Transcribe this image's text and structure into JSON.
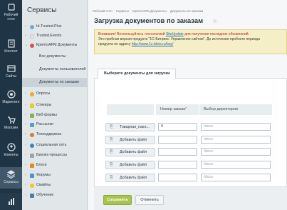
{
  "leftbar": {
    "items": [
      {
        "label1": "Рабочий",
        "label2": "стол"
      },
      {
        "label1": "Контент",
        "label2": ""
      },
      {
        "label1": "Сайты",
        "label2": ""
      },
      {
        "label1": "Маркетинг",
        "label2": ""
      },
      {
        "label1": "Магазин",
        "label2": ""
      },
      {
        "label1": "Клиенты",
        "label2": ""
      },
      {
        "label1": "Сервисы",
        "label2": ""
      }
    ]
  },
  "sidebar": {
    "title": "Сервисы",
    "items": [
      {
        "label": "Id.Trusted.Plus"
      },
      {
        "label": "Trusted.Events"
      },
      {
        "label": "КриптоАРМ Документы"
      },
      {
        "label": "Все документы"
      },
      {
        "label": "Документы пользователей"
      },
      {
        "label": "Документы по заказам"
      },
      {
        "label": "Опросы"
      },
      {
        "label": "Стикеры"
      },
      {
        "label": "Веб-формы"
      },
      {
        "label": "Рассылки"
      },
      {
        "label": "Техподдержка"
      },
      {
        "label": "Социальная сеть"
      },
      {
        "label": "Бизнес-процессы"
      },
      {
        "label": "Блоги"
      },
      {
        "label": "Форумы"
      },
      {
        "label": "Смайлы"
      },
      {
        "label": "Обучение"
      }
    ]
  },
  "breadcrumb": [
    "Рабочий стол",
    "Сервисы",
    "КриптоАРМ Документы",
    "Документы по заказам"
  ],
  "page": {
    "title": "Загрузка документов по заказам",
    "star": "☆"
  },
  "notice": {
    "line1_red": "Внимание! Воспользуйтесь технологией ",
    "link1": "SiteUpdate",
    "line1_rest": " для получения последних обновлений.",
    "line2": "Это пробная версия продукта \"1С-Битрикс: Управление сайтом\". До истечения пробного периода",
    "line3": "продукта по адресу ",
    "link2": "http://www.1c-bitrix.ru/buy/"
  },
  "tab": {
    "label": "Выберите документы для загрузки"
  },
  "table": {
    "col_order": "Номер заказа",
    "col_order_req": "*",
    "col_dir": "Выбор директории",
    "rows": [
      {
        "button": "Товарная_накл...",
        "order": "9",
        "dir": "/docs"
      },
      {
        "button": "Добавить файл",
        "order": "",
        "dir": "/docs"
      },
      {
        "button": "Добавить файл",
        "order": "",
        "dir": "/docs"
      },
      {
        "button": "Добавить файл",
        "order": "",
        "dir": "/docs"
      },
      {
        "button": "Добавить файл",
        "order": "",
        "dir": "/docs"
      }
    ]
  },
  "actions": {
    "save": "Сохранить",
    "cancel": "Отменить"
  },
  "colors": {
    "accent": "#a8c44e",
    "leftbar": "#1f3444"
  }
}
